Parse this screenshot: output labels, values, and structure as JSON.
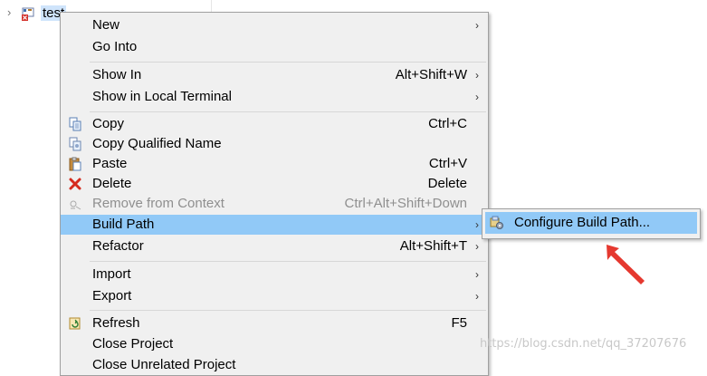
{
  "explorer": {
    "project_label": "test",
    "twistie_glyph": "›"
  },
  "context_menu": {
    "items": [
      {
        "label": "New",
        "accelerator": "",
        "submenu": true,
        "icon": ""
      },
      {
        "label": "Go Into",
        "accelerator": "",
        "submenu": false,
        "icon": ""
      },
      {
        "label": "Show In",
        "accelerator": "Alt+Shift+W",
        "submenu": true,
        "icon": ""
      },
      {
        "label": "Show in Local Terminal",
        "accelerator": "",
        "submenu": true,
        "icon": ""
      },
      {
        "label": "Copy",
        "accelerator": "Ctrl+C",
        "submenu": false,
        "icon": "copy-icon"
      },
      {
        "label": "Copy Qualified Name",
        "accelerator": "",
        "submenu": false,
        "icon": "copy-qualified-name-icon"
      },
      {
        "label": "Paste",
        "accelerator": "Ctrl+V",
        "submenu": false,
        "icon": "paste-icon"
      },
      {
        "label": "Delete",
        "accelerator": "Delete",
        "submenu": false,
        "icon": "delete-icon"
      },
      {
        "label": "Remove from Context",
        "accelerator": "Ctrl+Alt+Shift+Down",
        "submenu": false,
        "icon": "remove-from-context-icon",
        "disabled": true
      },
      {
        "label": "Build Path",
        "accelerator": "",
        "submenu": true,
        "icon": "",
        "highlighted": true
      },
      {
        "label": "Refactor",
        "accelerator": "Alt+Shift+T",
        "submenu": true,
        "icon": ""
      },
      {
        "label": "Import",
        "accelerator": "",
        "submenu": true,
        "icon": ""
      },
      {
        "label": "Export",
        "accelerator": "",
        "submenu": true,
        "icon": ""
      },
      {
        "label": "Refresh",
        "accelerator": "F5",
        "submenu": false,
        "icon": "refresh-icon"
      },
      {
        "label": "Close Project",
        "accelerator": "",
        "submenu": false,
        "icon": ""
      },
      {
        "label": "Close Unrelated Project",
        "accelerator": "",
        "submenu": false,
        "icon": ""
      }
    ],
    "submenu_arrow": "›"
  },
  "build_path_submenu": {
    "items": [
      {
        "label": "Configure Build Path...",
        "icon": "configure-build-path-icon",
        "highlighted": true
      }
    ]
  },
  "annotation": {
    "color": "#e5382f",
    "icon": "red-arrow-annotation"
  },
  "watermark": {
    "text": "https://blog.csdn.net/qq_37207676"
  },
  "colors": {
    "highlight": "#91c9f7",
    "menu_bg": "#f0f0f0",
    "disabled_text": "#8f8f8f"
  }
}
